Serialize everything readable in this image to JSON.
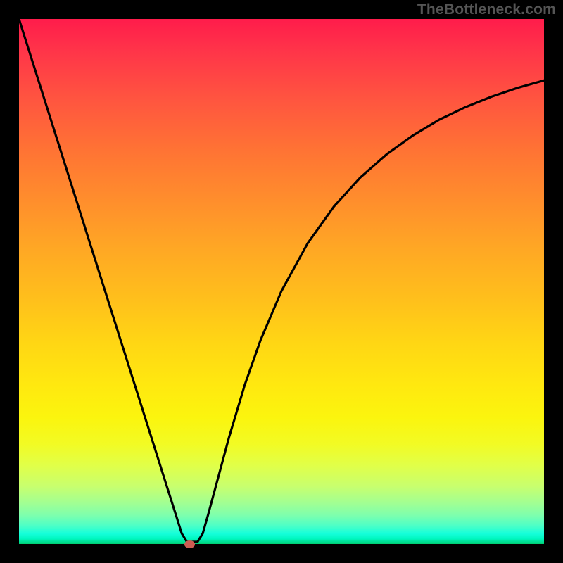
{
  "attribution": "TheBottleneck.com",
  "chart_data": {
    "type": "line",
    "title": "",
    "xlabel": "",
    "ylabel": "",
    "xlim": [
      0,
      100
    ],
    "ylim": [
      0,
      100
    ],
    "series": [
      {
        "name": "curve",
        "x": [
          0,
          5,
          10,
          15,
          20,
          25,
          28,
          30,
          31,
          32,
          33,
          34,
          35,
          36,
          38,
          40,
          43,
          46,
          50,
          55,
          60,
          65,
          70,
          75,
          80,
          85,
          90,
          95,
          100
        ],
        "y": [
          100,
          84.2,
          68.4,
          52.6,
          36.8,
          21.0,
          11.5,
          5.2,
          2.0,
          0.4,
          0.4,
          0.4,
          2.0,
          5.5,
          12.9,
          20.3,
          30.3,
          38.8,
          48.2,
          57.3,
          64.3,
          69.8,
          74.2,
          77.8,
          80.8,
          83.2,
          85.2,
          86.9,
          88.3
        ]
      }
    ],
    "marker": {
      "x": 32.5,
      "y": 0.0
    },
    "background_gradient": {
      "top": "#ff1c4b",
      "mid": "#ffd714",
      "bottom": "#00ce72"
    }
  }
}
